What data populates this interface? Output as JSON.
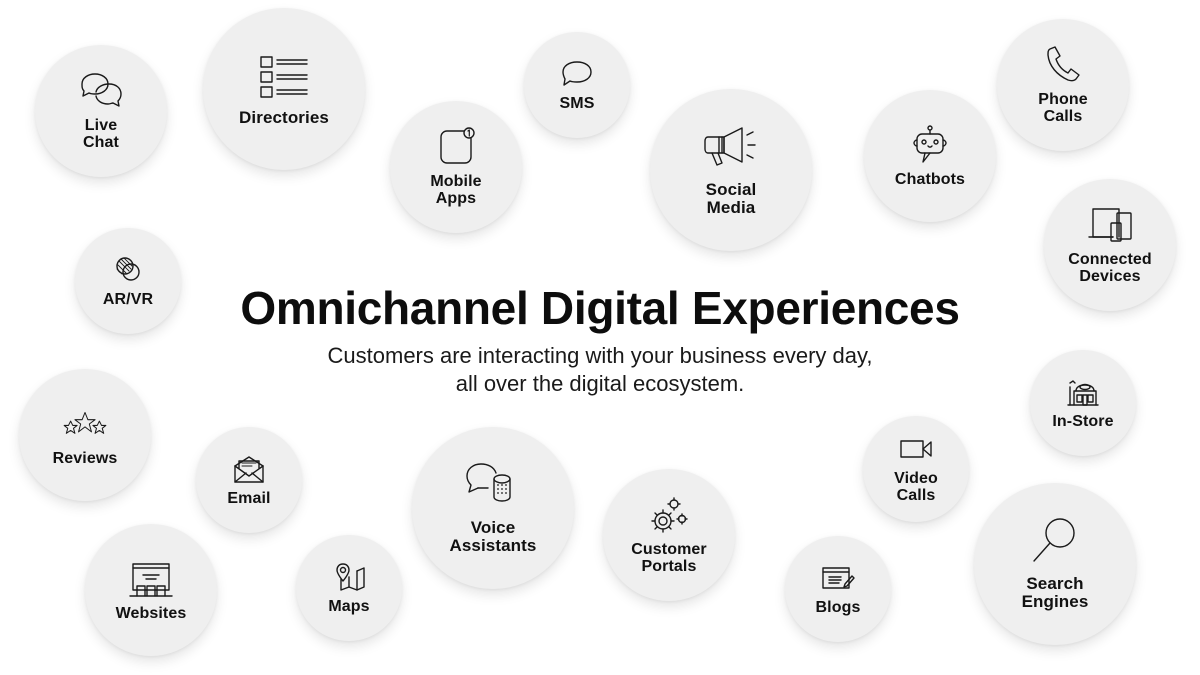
{
  "header": {
    "title": "Omnichannel Digital Experiences",
    "subtitle_line1": "Customers are interacting with your business every day,",
    "subtitle_line2": "all over the digital ecosystem."
  },
  "colors": {
    "background": "#ffffff",
    "bubble_fill": "#efefef",
    "text": "#111111"
  },
  "channels": [
    {
      "id": "live-chat",
      "label": "Live\nChat",
      "icon": "chat-bubbles-icon"
    },
    {
      "id": "directories",
      "label": "Directories",
      "icon": "list-checkbox-icon"
    },
    {
      "id": "sms",
      "label": "SMS",
      "icon": "speech-bubble-icon"
    },
    {
      "id": "mobile-apps",
      "label": "Mobile\nApps",
      "icon": "app-notification-icon",
      "badge": "1"
    },
    {
      "id": "social-media",
      "label": "Social\nMedia",
      "icon": "megaphone-icon"
    },
    {
      "id": "chatbots",
      "label": "Chatbots",
      "icon": "robot-icon"
    },
    {
      "id": "phone-calls",
      "label": "Phone\nCalls",
      "icon": "phone-icon"
    },
    {
      "id": "connected-devices",
      "label": "Connected\nDevices",
      "icon": "devices-icon"
    },
    {
      "id": "ar-vr",
      "label": "AR/VR",
      "icon": "overlap-circles-icon"
    },
    {
      "id": "in-store",
      "label": "In-Store",
      "icon": "storefront-icon"
    },
    {
      "id": "reviews",
      "label": "Reviews",
      "icon": "stars-icon"
    },
    {
      "id": "email",
      "label": "Email",
      "icon": "envelope-icon"
    },
    {
      "id": "voice-assistants",
      "label": "Voice\nAssistants",
      "icon": "smart-speaker-icon"
    },
    {
      "id": "customer-portals",
      "label": "Customer\nPortals",
      "icon": "gears-icon"
    },
    {
      "id": "video-calls",
      "label": "Video\nCalls",
      "icon": "video-camera-icon"
    },
    {
      "id": "websites",
      "label": "Websites",
      "icon": "browser-storefront-icon"
    },
    {
      "id": "maps",
      "label": "Maps",
      "icon": "map-pin-icon"
    },
    {
      "id": "blogs",
      "label": "Blogs",
      "icon": "blog-edit-icon"
    },
    {
      "id": "search-engines",
      "label": "Search\nEngines",
      "icon": "magnifier-icon"
    }
  ]
}
